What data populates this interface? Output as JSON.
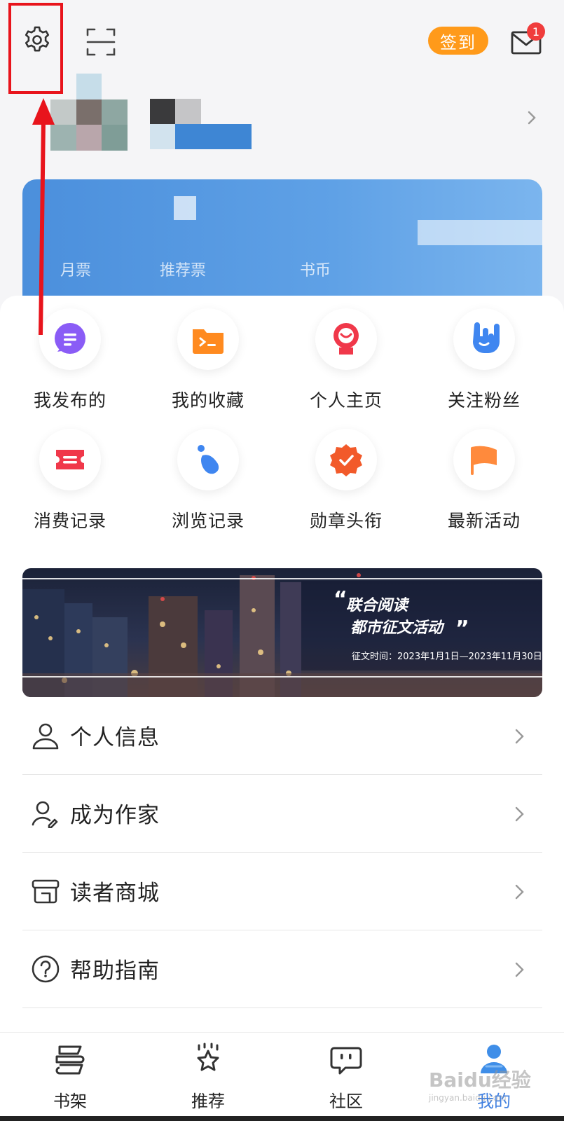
{
  "header": {
    "checkin_label": "签到",
    "mail_badge": "1"
  },
  "vip_card": {
    "stats": [
      "月票",
      "推荐票",
      "书币"
    ]
  },
  "quick_actions": [
    {
      "label": "我发布的",
      "icon": "chat-icon",
      "color": "#8a5cf6"
    },
    {
      "label": "我的收藏",
      "icon": "folder-icon",
      "color": "#ff8a1f"
    },
    {
      "label": "个人主页",
      "icon": "avatar-icon",
      "color": "#f0384a"
    },
    {
      "label": "关注粉丝",
      "icon": "hand-icon",
      "color": "#3f86f0"
    },
    {
      "label": "消费记录",
      "icon": "ticket-icon",
      "color": "#f0384a"
    },
    {
      "label": "浏览记录",
      "icon": "footprint-icon",
      "color": "#3f86f0"
    },
    {
      "label": "勋章头衔",
      "icon": "badge-icon",
      "color": "#f25a2a"
    },
    {
      "label": "最新活动",
      "icon": "flag-icon",
      "color": "#ff8a3c"
    }
  ],
  "banner": {
    "line1": "联合阅读",
    "line2": "都市征文活动",
    "date": "征文时间：2023年1月1日—2023年11月30日"
  },
  "menu": [
    {
      "label": "个人信息",
      "icon": "person-icon"
    },
    {
      "label": "成为作家",
      "icon": "writer-icon"
    },
    {
      "label": "读者商城",
      "icon": "store-icon"
    },
    {
      "label": "帮助指南",
      "icon": "help-icon"
    }
  ],
  "tabs": [
    {
      "label": "书架",
      "icon": "bookshelf-icon"
    },
    {
      "label": "推荐",
      "icon": "star-icon"
    },
    {
      "label": "社区",
      "icon": "community-icon"
    },
    {
      "label": "我的",
      "icon": "profile-icon",
      "active": true
    }
  ],
  "watermark": {
    "brand": "Baidu经验",
    "url": "jingyan.baidu.com"
  }
}
